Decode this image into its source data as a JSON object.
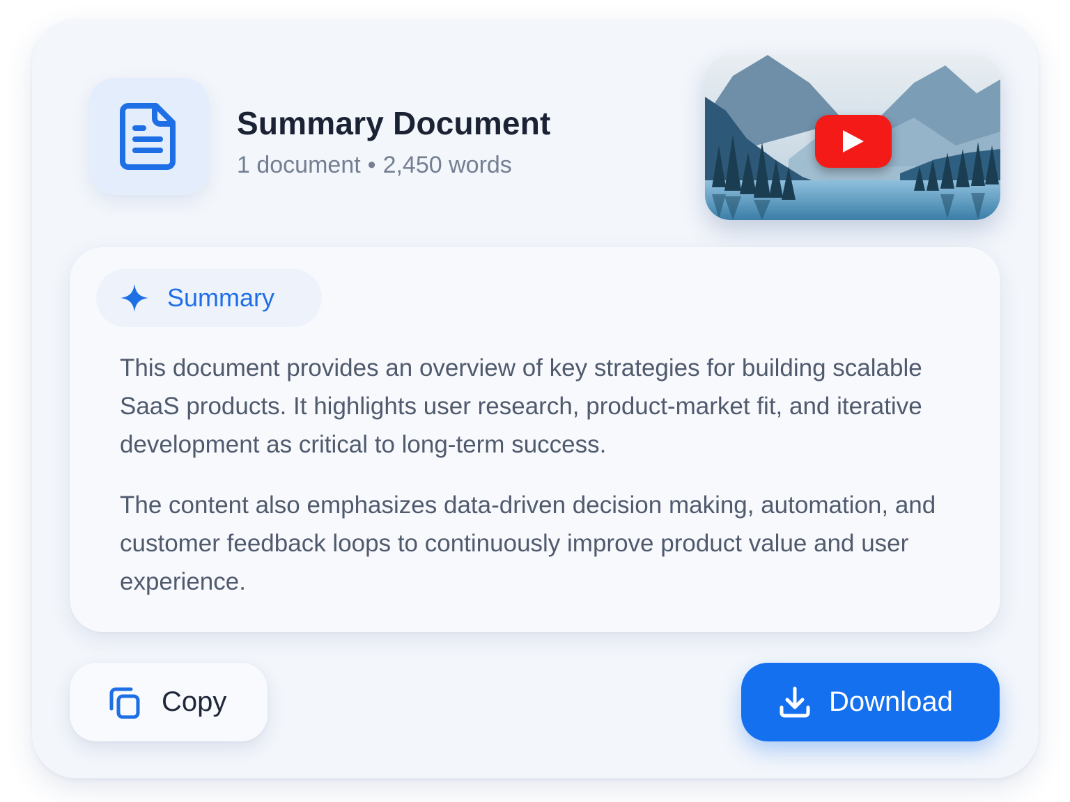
{
  "header": {
    "title": "Summary Document",
    "document_count": "1 document",
    "separator": "•",
    "word_count": "2,450 words",
    "file_icon": "document-icon"
  },
  "video": {
    "thumbnail": "mountain-lake-thumbnail",
    "play_icon": "play-icon"
  },
  "summary": {
    "chip_label": "Summary",
    "chip_icon": "sparkle-icon",
    "paragraphs": [
      "This document provides an overview of key strategies for building scalable SaaS products. It highlights user research, product-market fit, and iterative development as critical to long-term success.",
      "The content also emphasizes data-driven decision making, automation, and customer feedback loops to continuously improve product value and user experience."
    ]
  },
  "actions": {
    "copy_label": "Copy",
    "copy_icon": "copy-icon",
    "download_label": "Download",
    "download_icon": "download-icon"
  },
  "colors": {
    "accent": "#1570f0",
    "accent_text": "#1e6fe6",
    "title": "#1a2233",
    "muted": "#747f92",
    "body": "#505a6d",
    "play_red": "#f41a17"
  }
}
